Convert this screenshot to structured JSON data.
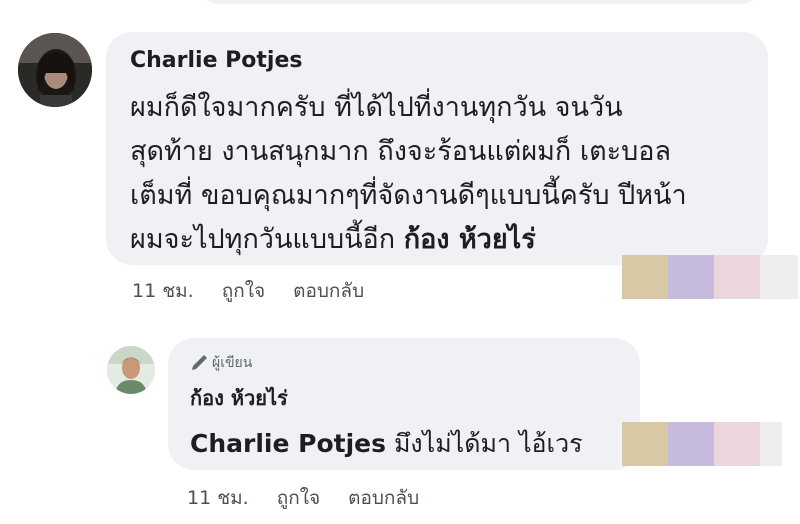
{
  "comment": {
    "author": "Charlie Potjes",
    "text_lines": [
      "ผมก็ดีใจมากครับ ที่ได้ไปที่งานทุกวัน จนวัน",
      "สุดท้าย งานสนุกมาก ถึงจะร้อนแต่ผมก็ เตะบอล",
      "เต็มที่ ขอบคุณมากๆที่จัดงานดีๆแบบนี้ครับ ปีหน้า",
      "ผมจะไปทุกวันแบบนี้อีก "
    ],
    "mention": "ก้อง ห้วยไร่",
    "time": "11 ชม.",
    "like": "ถูกใจ",
    "reply": "ตอบกลับ"
  },
  "reply": {
    "badge": "ผู้เขียน",
    "badge_icon": "pencil-icon",
    "author": "ก้อง ห้วยไร่",
    "mention": "Charlie Potjes",
    "text": " มึงไม่ได้มา ไอ้เวร",
    "time": "11 ชม.",
    "like": "ถูกใจ",
    "reply": "ตอบกลับ"
  },
  "colors": {
    "bubble": "#eff1f4",
    "text": "#1c1e21",
    "meta": "#4b4f56",
    "redaction": [
      "#d8c8a4",
      "#c6bbdc",
      "#ead6dc",
      "#eeeeee"
    ]
  }
}
